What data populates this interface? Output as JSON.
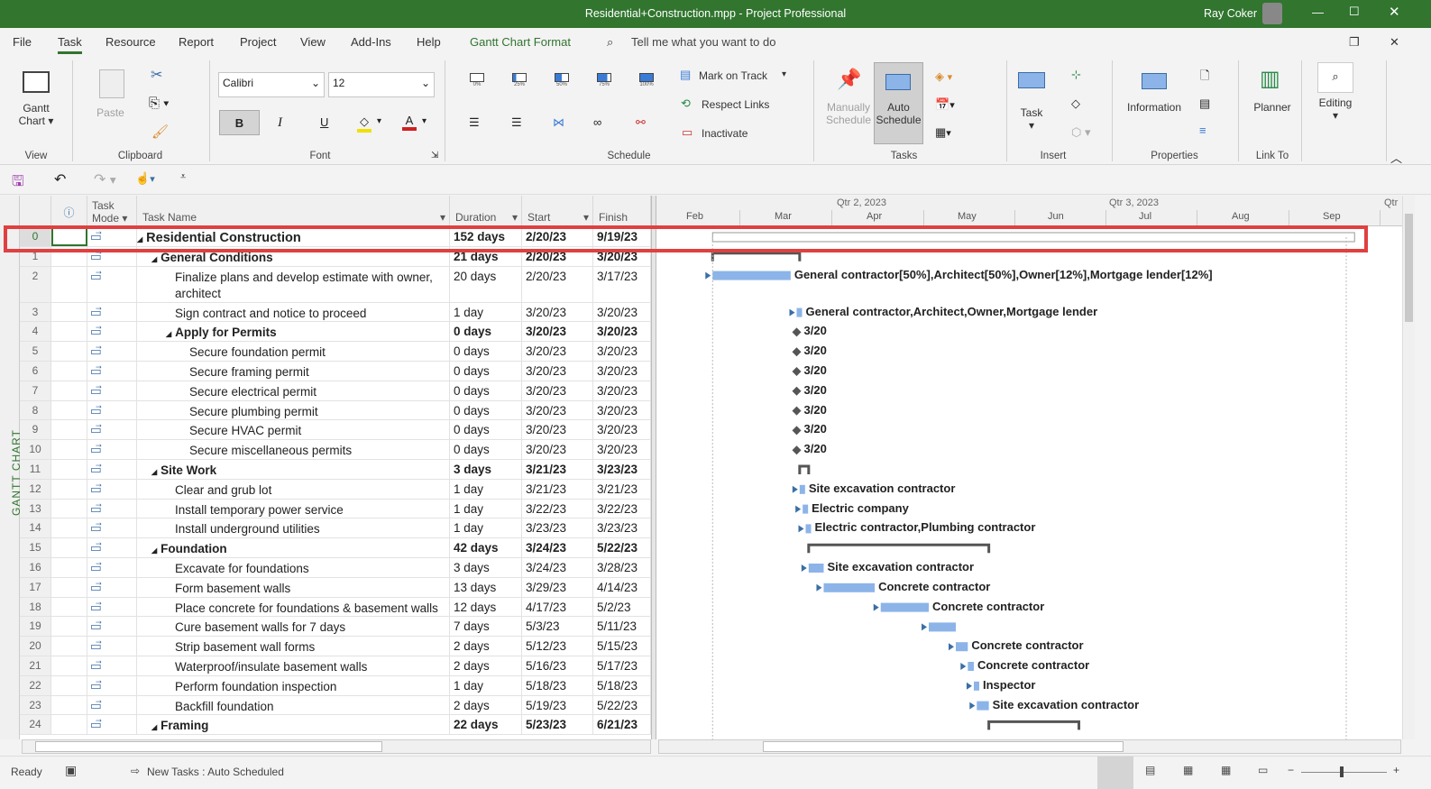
{
  "window": {
    "title": "Residential+Construction.mpp  -  Project Professional",
    "user": "Ray Coker"
  },
  "menu": [
    "File",
    "Task",
    "Resource",
    "Report",
    "Project",
    "View",
    "Add-Ins",
    "Help",
    "Gantt Chart Format"
  ],
  "tell_me": "Tell me what you want to do",
  "ribbon": {
    "view": {
      "gantt_label": "Gantt",
      "gantt_label2": "Chart",
      "group": "View"
    },
    "clipboard": {
      "paste": "Paste",
      "group": "Clipboard"
    },
    "font": {
      "family": "Calibri",
      "size": "12",
      "bold": "B",
      "italic": "I",
      "underline": "U",
      "group": "Font"
    },
    "schedule": {
      "pcts": [
        "0%",
        "25%",
        "50%",
        "75%",
        "100%"
      ],
      "mark_on_track": "Mark on Track",
      "respect_links": "Respect Links",
      "inactivate": "Inactivate",
      "group": "Schedule"
    },
    "tasks": {
      "manually": "Manually",
      "manually2": "Schedule",
      "auto": "Auto",
      "auto2": "Schedule",
      "group": "Tasks"
    },
    "insert": {
      "task": "Task",
      "group": "Insert"
    },
    "properties": {
      "information": "Information",
      "group": "Properties"
    },
    "linkto": {
      "planner": "Planner",
      "group": "Link To"
    },
    "editing": {
      "label": "Editing"
    }
  },
  "side_label": "GANTT CHART",
  "columns": {
    "mode1": "Task",
    "mode2": "Mode",
    "name": "Task Name",
    "duration": "Duration",
    "start": "Start",
    "finish": "Finish"
  },
  "timescale": {
    "quarters": [
      "Qtr 2, 2023",
      "Qtr 3, 2023",
      "Qtr"
    ],
    "months": [
      "Feb",
      "Mar",
      "Apr",
      "May",
      "Jun",
      "Jul",
      "Aug",
      "Sep"
    ]
  },
  "tasks": [
    {
      "id": "0",
      "name": "Residential Construction",
      "level": 0,
      "summary": true,
      "duration": "152 days",
      "start": "2/20/23",
      "finish": "9/19/23",
      "res": ""
    },
    {
      "id": "1",
      "name": "General Conditions",
      "level": 1,
      "summary": true,
      "duration": "21 days",
      "start": "2/20/23",
      "finish": "3/20/23",
      "res": ""
    },
    {
      "id": "2",
      "name": "Finalize plans and develop estimate with owner,",
      "name2": "architect",
      "level": 2,
      "duration": "20 days",
      "start": "2/20/23",
      "finish": "3/17/23",
      "res": "General contractor[50%],Architect[50%],Owner[12%],Mortgage lender[12%]"
    },
    {
      "id": "3",
      "name": "Sign contract and notice to proceed",
      "level": 2,
      "duration": "1 day",
      "start": "3/20/23",
      "finish": "3/20/23",
      "res": "General contractor,Architect,Owner,Mortgage lender"
    },
    {
      "id": "4",
      "name": "Apply for Permits",
      "level": 2,
      "summary": true,
      "duration": "0 days",
      "start": "3/20/23",
      "finish": "3/20/23",
      "res": "3/20",
      "milestone": true
    },
    {
      "id": "5",
      "name": "Secure foundation permit",
      "level": 3,
      "duration": "0 days",
      "start": "3/20/23",
      "finish": "3/20/23",
      "res": "3/20",
      "milestone": true
    },
    {
      "id": "6",
      "name": "Secure framing permit",
      "level": 3,
      "duration": "0 days",
      "start": "3/20/23",
      "finish": "3/20/23",
      "res": "3/20",
      "milestone": true
    },
    {
      "id": "7",
      "name": "Secure electrical permit",
      "level": 3,
      "duration": "0 days",
      "start": "3/20/23",
      "finish": "3/20/23",
      "res": "3/20",
      "milestone": true
    },
    {
      "id": "8",
      "name": "Secure plumbing permit",
      "level": 3,
      "duration": "0 days",
      "start": "3/20/23",
      "finish": "3/20/23",
      "res": "3/20",
      "milestone": true
    },
    {
      "id": "9",
      "name": "Secure HVAC permit",
      "level": 3,
      "duration": "0 days",
      "start": "3/20/23",
      "finish": "3/20/23",
      "res": "3/20",
      "milestone": true
    },
    {
      "id": "10",
      "name": "Secure miscellaneous permits",
      "level": 3,
      "duration": "0 days",
      "start": "3/20/23",
      "finish": "3/20/23",
      "res": "3/20",
      "milestone": true
    },
    {
      "id": "11",
      "name": "Site Work",
      "level": 1,
      "summary": true,
      "duration": "3 days",
      "start": "3/21/23",
      "finish": "3/23/23",
      "res": ""
    },
    {
      "id": "12",
      "name": "Clear and grub lot",
      "level": 2,
      "duration": "1 day",
      "start": "3/21/23",
      "finish": "3/21/23",
      "res": "Site excavation contractor"
    },
    {
      "id": "13",
      "name": "Install temporary power service",
      "level": 2,
      "duration": "1 day",
      "start": "3/22/23",
      "finish": "3/22/23",
      "res": "Electric company"
    },
    {
      "id": "14",
      "name": "Install underground utilities",
      "level": 2,
      "duration": "1 day",
      "start": "3/23/23",
      "finish": "3/23/23",
      "res": "Electric contractor,Plumbing contractor"
    },
    {
      "id": "15",
      "name": "Foundation",
      "level": 1,
      "summary": true,
      "duration": "42 days",
      "start": "3/24/23",
      "finish": "5/22/23",
      "res": ""
    },
    {
      "id": "16",
      "name": "Excavate for foundations",
      "level": 2,
      "duration": "3 days",
      "start": "3/24/23",
      "finish": "3/28/23",
      "res": "Site excavation contractor"
    },
    {
      "id": "17",
      "name": "Form basement walls",
      "level": 2,
      "duration": "13 days",
      "start": "3/29/23",
      "finish": "4/14/23",
      "res": "Concrete contractor"
    },
    {
      "id": "18",
      "name": "Place concrete for foundations & basement walls",
      "level": 2,
      "duration": "12 days",
      "start": "4/17/23",
      "finish": "5/2/23",
      "res": "Concrete contractor"
    },
    {
      "id": "19",
      "name": "Cure basement walls for 7 days",
      "level": 2,
      "duration": "7 days",
      "start": "5/3/23",
      "finish": "5/11/23",
      "res": ""
    },
    {
      "id": "20",
      "name": "Strip basement wall forms",
      "level": 2,
      "duration": "2 days",
      "start": "5/12/23",
      "finish": "5/15/23",
      "res": "Concrete contractor"
    },
    {
      "id": "21",
      "name": "Waterproof/insulate basement walls",
      "level": 2,
      "duration": "2 days",
      "start": "5/16/23",
      "finish": "5/17/23",
      "res": "Concrete contractor"
    },
    {
      "id": "22",
      "name": "Perform foundation inspection",
      "level": 2,
      "duration": "1 day",
      "start": "5/18/23",
      "finish": "5/18/23",
      "res": "Inspector"
    },
    {
      "id": "23",
      "name": "Backfill foundation",
      "level": 2,
      "duration": "2 days",
      "start": "5/19/23",
      "finish": "5/22/23",
      "res": "Site excavation contractor"
    },
    {
      "id": "24",
      "name": "Framing",
      "level": 1,
      "summary": true,
      "duration": "22 days",
      "start": "5/23/23",
      "finish": "6/21/23",
      "res": ""
    }
  ],
  "status": {
    "ready": "Ready",
    "new_tasks": "New Tasks : Auto Scheduled"
  },
  "colors": {
    "brand": "#31752f",
    "bar": "#8cb4e8",
    "highlight": "#e04040"
  }
}
